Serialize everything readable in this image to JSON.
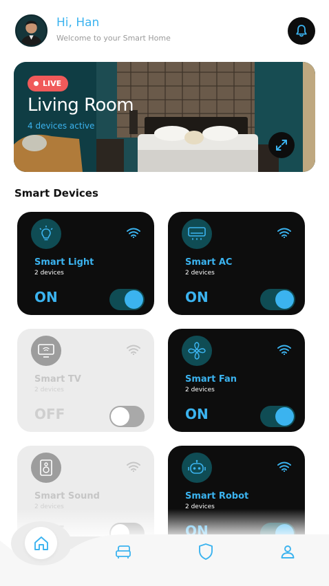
{
  "header": {
    "greeting": "Hi, Han",
    "subtitle": "Welcome to your Smart Home",
    "avatar_icon": "user-avatar",
    "bell_icon": "bell-icon"
  },
  "room": {
    "live_label": "LIVE",
    "name": "Living Room",
    "device_count": "4 devices active",
    "expand_icon": "expand-icon"
  },
  "section": {
    "title": "Smart Devices"
  },
  "devices": [
    {
      "name": "Smart Light",
      "count": "2 devices",
      "state": "ON",
      "on": true,
      "icon": "lightbulb-icon"
    },
    {
      "name": "Smart AC",
      "count": "2 devices",
      "state": "ON",
      "on": true,
      "icon": "air-conditioner-icon"
    },
    {
      "name": "Smart TV",
      "count": "2 devices",
      "state": "OFF",
      "on": false,
      "icon": "tv-icon"
    },
    {
      "name": "Smart Fan",
      "count": "2 devices",
      "state": "ON",
      "on": true,
      "icon": "fan-icon"
    },
    {
      "name": "Smart Sound",
      "count": "2 devices",
      "state": "OFF",
      "on": false,
      "icon": "speaker-icon"
    },
    {
      "name": "Smart Robot",
      "count": "2 devices",
      "state": "ON",
      "on": true,
      "icon": "robot-icon"
    }
  ],
  "nav": {
    "items": [
      "home-icon",
      "sofa-icon",
      "shield-icon",
      "profile-icon"
    ],
    "active": "home-icon"
  },
  "colors": {
    "accent": "#3bb3ef",
    "card_dark": "#0d0d0d",
    "card_off": "#ececec",
    "icon_bg_on": "#0f4c54",
    "live_badge": "#f05a5a"
  }
}
